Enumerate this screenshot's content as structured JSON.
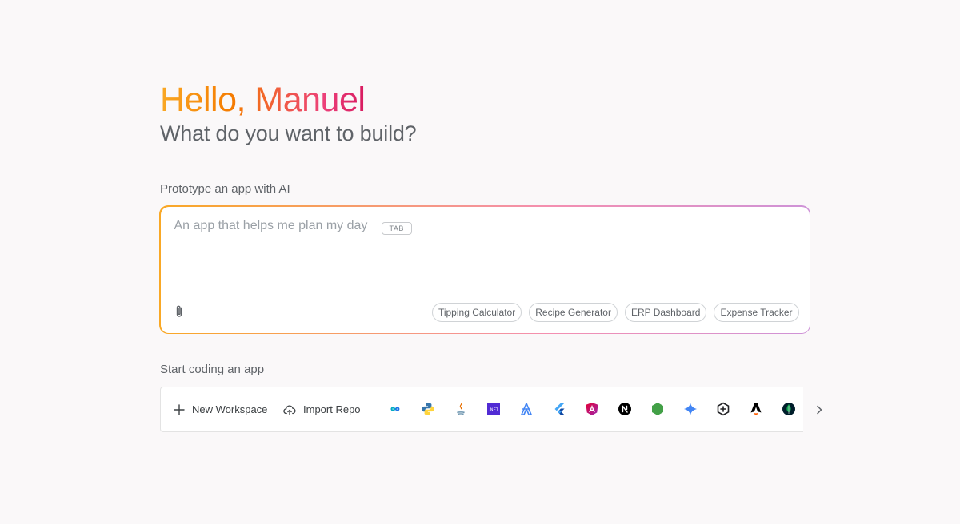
{
  "greeting": "Hello, Manuel",
  "subtitle": "What do you want to build?",
  "prototype": {
    "label": "Prototype an app with AI",
    "placeholder": "An app that helps me plan my day",
    "tab_hint": "TAB",
    "attach_icon": "paperclip-icon",
    "suggestions": [
      "Tipping Calculator",
      "Recipe Generator",
      "ERP Dashboard",
      "Expense Tracker"
    ]
  },
  "coding": {
    "label": "Start coding an app",
    "new_workspace": "New Workspace",
    "import_repo": "Import Repo",
    "templates": [
      {
        "icon": "infinity-icon",
        "color": "#1a73e8"
      },
      {
        "icon": "python-icon",
        "color": "#3776ab"
      },
      {
        "icon": "java-icon",
        "color": "#e76f00"
      },
      {
        "icon": "dotnet-icon",
        "color": "#512bd4",
        "text": ".NET"
      },
      {
        "icon": "astro-icon",
        "color": "#4285f4"
      },
      {
        "icon": "flutter-icon",
        "color": "#42a5f5"
      },
      {
        "icon": "angular-icon",
        "color": "#dd0031"
      },
      {
        "icon": "nextjs-icon",
        "color": "#000000"
      },
      {
        "icon": "nodejs-icon",
        "color": "#43a047"
      },
      {
        "icon": "gemini-icon",
        "color": "#4285f4"
      },
      {
        "icon": "hexagon-plus-icon",
        "color": "#202124"
      },
      {
        "icon": "astro-logo-icon",
        "color": "#000000"
      },
      {
        "icon": "mongodb-icon",
        "color": "#13aa52"
      }
    ],
    "scroll_icon": "chevron-right-icon"
  }
}
